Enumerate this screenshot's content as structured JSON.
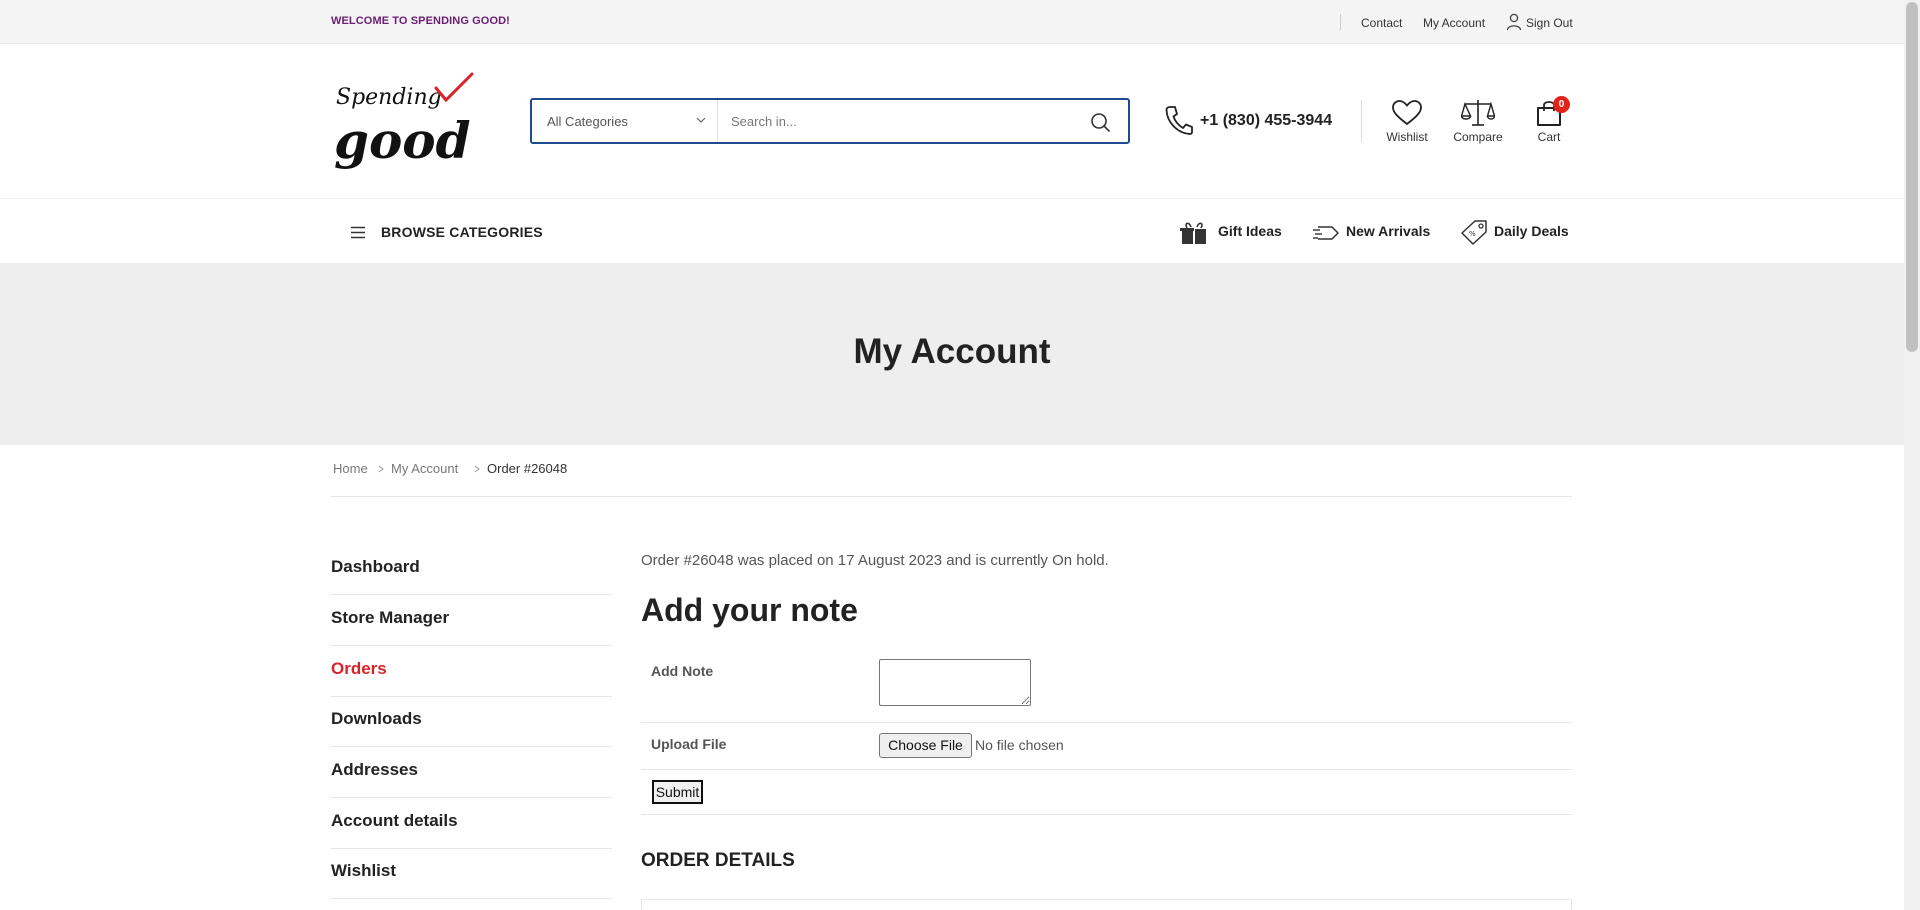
{
  "topbar": {
    "welcome": "WELCOME TO SPENDING GOOD!",
    "links": {
      "contact": "Contact",
      "my_account": "My Account",
      "sign_out": "Sign Out"
    }
  },
  "header": {
    "logo": {
      "text_top": "Spending",
      "text_bottom": "good",
      "accent_color": "#d8232a"
    },
    "search": {
      "category": "All Categories",
      "placeholder": "Search in..."
    },
    "phone": "+1 (830) 455-3944",
    "actions": {
      "wishlist": "Wishlist",
      "compare": "Compare",
      "cart": "Cart",
      "cart_count": "0"
    }
  },
  "nav": {
    "browse": "BROWSE CATEGORIES",
    "links": {
      "gift_ideas": "Gift Ideas",
      "new_arrivals": "New Arrivals",
      "daily_deals": "Daily Deals"
    }
  },
  "banner": {
    "title": "My Account"
  },
  "breadcrumb": {
    "home": "Home",
    "my_account": "My Account",
    "current": "Order #26048"
  },
  "sidebar": {
    "items": [
      {
        "label": "Dashboard",
        "active": false
      },
      {
        "label": "Store Manager",
        "active": false
      },
      {
        "label": "Orders",
        "active": true
      },
      {
        "label": "Downloads",
        "active": false
      },
      {
        "label": "Addresses",
        "active": false
      },
      {
        "label": "Account details",
        "active": false
      },
      {
        "label": "Wishlist",
        "active": false
      }
    ]
  },
  "main": {
    "order_message": "Order #26048 was placed on 17 August 2023 and is currently On hold.",
    "note_heading": "Add your note",
    "add_note_label": "Add Note",
    "upload_label": "Upload File",
    "choose_file": "Choose File",
    "file_status": "No file chosen",
    "submit": "Submit",
    "details_heading": "ORDER DETAILS"
  },
  "colors": {
    "accent": "#d8232a",
    "brand_purple": "#6a1d72",
    "search_border": "#1d4b8f"
  }
}
